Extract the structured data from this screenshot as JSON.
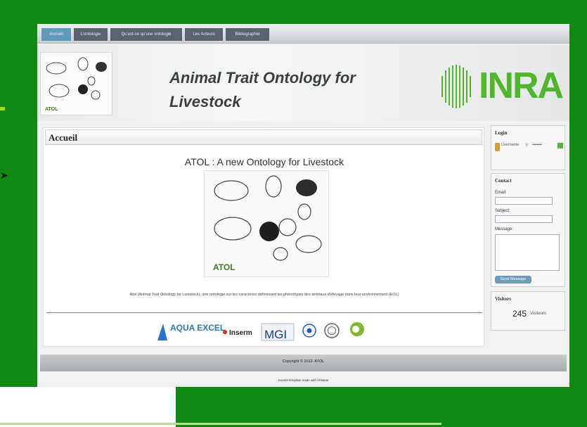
{
  "nav": {
    "items": [
      "Accueil",
      "L'ontologie",
      "Qu'est-ce qu'une ontologie",
      "Les Acteurs",
      "Bibliographie"
    ]
  },
  "header": {
    "title": "Animal Trait Ontology for Livestock",
    "logo_text": "INRA",
    "image_label": "ATOL"
  },
  "main": {
    "section_title": "Accueil",
    "heading": "ATOL : A new Ontology for Livestock",
    "image_label": "ATOL",
    "description": "Atol (Animal Trait Ontology for Livestock), une ontologie sur les caractères définissant les phénotypes des animaux d'élevage dans leur environnement (EOL)",
    "partners": [
      "AQUA EXCEL",
      "Inserm",
      "MGI",
      "Agreenium"
    ]
  },
  "sidebar": {
    "login": {
      "title": "Login",
      "username_placeholder": "Username",
      "password_placeholder": "••••••••"
    },
    "contact": {
      "title": "Contact",
      "email_label": "Email:",
      "subject_label": "Subject:",
      "message_label": "Message:",
      "send_label": "Send Message"
    },
    "visitors": {
      "title": "Visitors",
      "count": "245",
      "unit": "Visiteurs"
    }
  },
  "footer": {
    "copyright": "Copyright © 2012. ATOL",
    "credit": "Joomla template made with Artisteer"
  },
  "colors": {
    "slide_green": "#0f8a12",
    "nav_active": "#5f9bb8",
    "inra_green": "#52b52e"
  }
}
